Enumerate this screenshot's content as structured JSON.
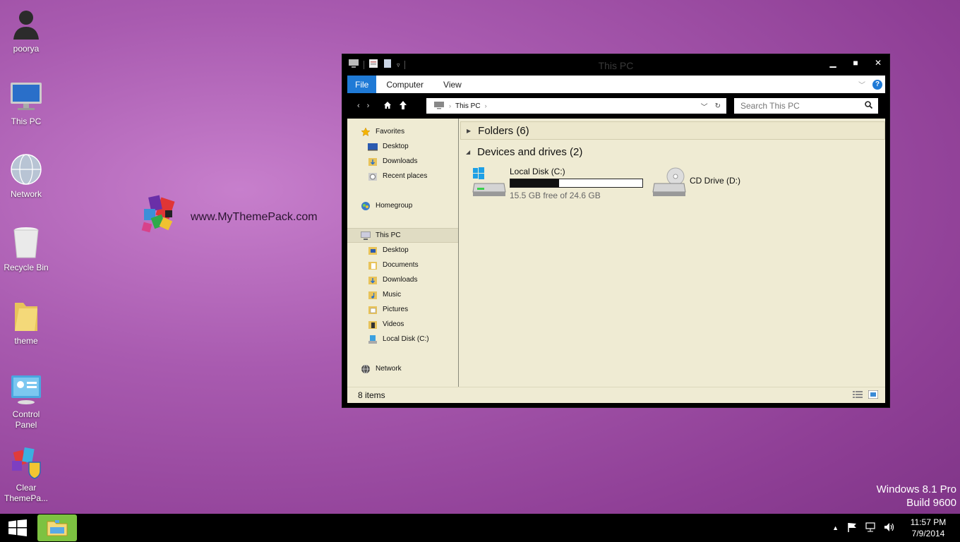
{
  "desktop": {
    "icons": [
      {
        "label": "poorya",
        "icon": "user-icon"
      },
      {
        "label": "This PC",
        "icon": "computer-icon"
      },
      {
        "label": "Network",
        "icon": "network-globe-icon"
      },
      {
        "label": "Recycle Bin",
        "icon": "recycle-bin-icon"
      },
      {
        "label": "theme",
        "icon": "folder-icon"
      },
      {
        "label": "Control Panel",
        "icon": "control-panel-icon"
      },
      {
        "label": "Clear ThemePa...",
        "icon": "themepack-shield-icon"
      }
    ],
    "logo_text": "www.MyThemePack.com"
  },
  "window": {
    "title": "This PC",
    "ribbon_tabs": [
      "File",
      "Computer",
      "View"
    ],
    "address_path": "This PC",
    "search_placeholder": "Search This PC",
    "nav_pane": {
      "favorites": "Favorites",
      "favorites_items": [
        "Desktop",
        "Downloads",
        "Recent places"
      ],
      "homegroup": "Homegroup",
      "this_pc": "This PC",
      "this_pc_items": [
        "Desktop",
        "Documents",
        "Downloads",
        "Music",
        "Pictures",
        "Videos",
        "Local Disk (C:)"
      ],
      "network": "Network"
    },
    "groups": {
      "folders": "Folders (6)",
      "devices": "Devices and drives (2)"
    },
    "drives": [
      {
        "name": "Local Disk (C:)",
        "free_text": "15.5 GB free of 24.6 GB",
        "used_fraction": 0.37
      },
      {
        "name": "CD Drive (D:)"
      }
    ],
    "status": "8 items"
  },
  "watermark": {
    "line1": "Windows 8.1 Pro",
    "line2": "Build 9600"
  },
  "taskbar": {
    "time": "11:57 PM",
    "date": "7/9/2014"
  },
  "colors": {
    "accent": "#1f7ad6",
    "content_bg": "#efebd3",
    "desktop_bg": "#a95bb0",
    "taskbar_app": "#7dc241"
  }
}
